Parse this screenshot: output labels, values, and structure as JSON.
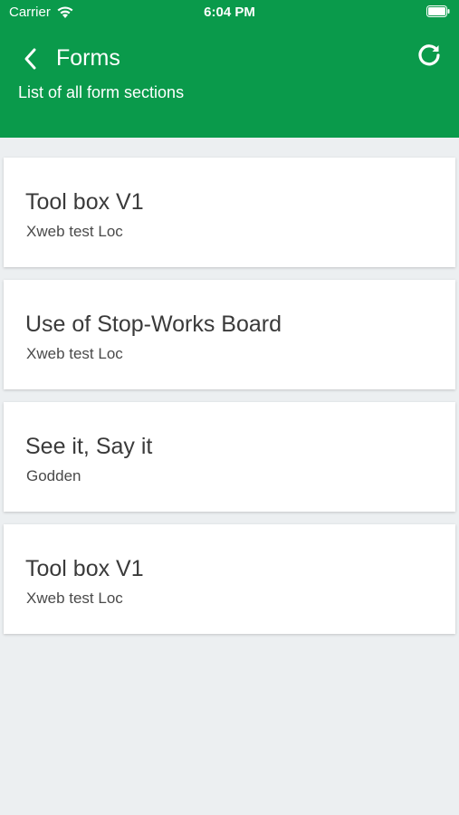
{
  "status_bar": {
    "carrier": "Carrier",
    "time": "6:04 PM",
    "wifi_icon": "wifi-icon",
    "battery_icon": "battery-icon"
  },
  "header": {
    "title": "Forms",
    "subtitle": "List of all form sections",
    "back_icon": "chevron-left-icon",
    "refresh_icon": "refresh-icon",
    "background_color": "#0a9a4b"
  },
  "forms": [
    {
      "title": "Tool box V1",
      "location": "Xweb test Loc"
    },
    {
      "title": "Use of Stop-Works Board",
      "location": "Xweb test Loc"
    },
    {
      "title": "See it, Say it",
      "location": "Godden"
    },
    {
      "title": "Tool box V1",
      "location": "Xweb test Loc"
    }
  ]
}
